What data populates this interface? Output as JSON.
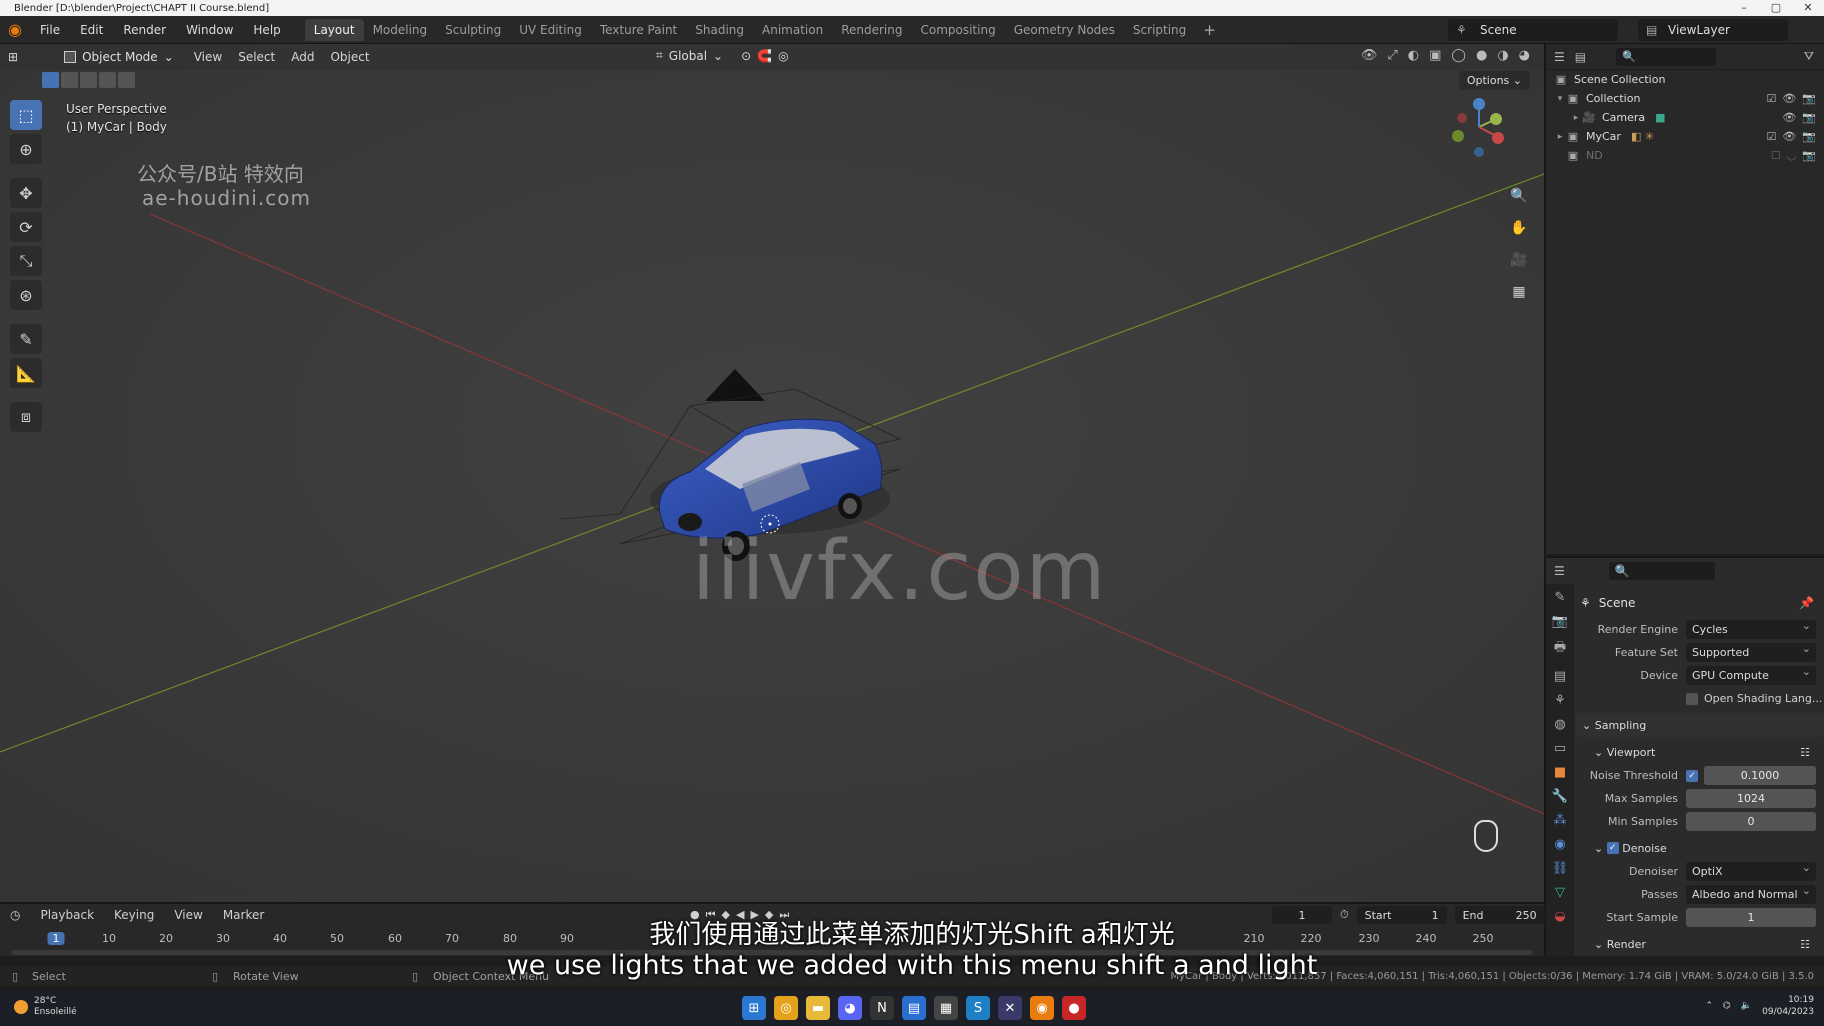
{
  "window": {
    "title": "Blender [D:\\blender\\Project\\CHAPT II Course.blend]"
  },
  "menu": {
    "file": "File",
    "edit": "Edit",
    "render": "Render",
    "window": "Window",
    "help": "Help"
  },
  "workspaces": [
    "Layout",
    "Modeling",
    "Sculpting",
    "UV Editing",
    "Texture Paint",
    "Shading",
    "Animation",
    "Rendering",
    "Compositing",
    "Geometry Nodes",
    "Scripting"
  ],
  "active_workspace": "Layout",
  "scene_name": "Scene",
  "view_layer": "ViewLayer",
  "viewport": {
    "mode": "Object Mode",
    "menus": [
      "View",
      "Select",
      "Add",
      "Object"
    ],
    "transform_orientation": "Global",
    "options_label": "Options",
    "info_line1": "User Perspective",
    "info_line2": "(1) MyCar | Body"
  },
  "watermarks": {
    "cn": "公众号/B站 特效向",
    "url": "ae-houdini.com",
    "big": "iiivfx.com"
  },
  "outliner": {
    "root": "Scene Collection",
    "items": [
      {
        "label": "Collection",
        "icon": "collection-icon"
      },
      {
        "label": "Camera",
        "icon": "camera-icon"
      },
      {
        "label": "MyCar",
        "icon": "collection-icon"
      },
      {
        "label": "ND",
        "icon": "collection-icon"
      }
    ]
  },
  "properties": {
    "scene_title": "Scene",
    "render_engine_label": "Render Engine",
    "render_engine": "Cycles",
    "feature_set_label": "Feature Set",
    "feature_set": "Supported",
    "device_label": "Device",
    "device": "GPU Compute",
    "osl_label": "Open Shading Lang...",
    "sampling": "Sampling",
    "viewport": "Viewport",
    "noise_threshold_label": "Noise Threshold",
    "noise_threshold": "0.1000",
    "max_samples_label": "Max Samples",
    "max_samples": "1024",
    "min_samples_label": "Min Samples",
    "min_samples": "0",
    "denoise": "Denoise",
    "denoiser_label": "Denoiser",
    "denoiser": "OptiX",
    "passes_label": "Passes",
    "passes": "Albedo and Normal",
    "start_sample_label": "Start Sample",
    "start_sample": "1",
    "render": "Render"
  },
  "timeline": {
    "menus": [
      "Playback",
      "Keying",
      "View",
      "Marker"
    ],
    "current_frame": "1",
    "start_label": "Start",
    "start": "1",
    "end_label": "End",
    "end": "250",
    "ticks": [
      "1",
      "10",
      "20",
      "30",
      "40",
      "50",
      "60",
      "70",
      "80",
      "90",
      "210",
      "220",
      "230",
      "240",
      "250"
    ]
  },
  "status": {
    "select": "Select",
    "rotate": "Rotate View",
    "context": "Object Context Menu",
    "stats": "MyCar | Body | Verts:4,011,857 | Faces:4,060,151 | Tris:4,060,151 | Objects:0/36 | Memory: 1.74 GiB | VRAM: 5.0/24.0 GiB | 3.5.0"
  },
  "subtitles": {
    "cn": "我们使用通过此菜单添加的灯光Shift a和灯光",
    "en": "we use lights that we added with this menu shift a and light"
  },
  "taskbar": {
    "weather_temp": "28°C",
    "weather_desc": "Ensoleillé",
    "time": "10:19",
    "date": "09/04/2023"
  },
  "colors": {
    "accent": "#4772b3",
    "car": "#2b4aa8",
    "x_axis": "#8a3535",
    "y_axis": "#6f8a2a"
  }
}
